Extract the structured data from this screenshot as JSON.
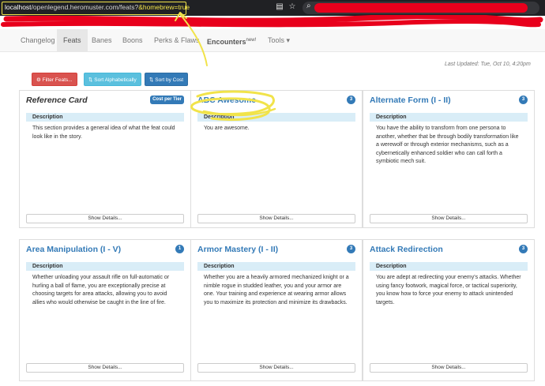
{
  "browser": {
    "url_domain": "localhost",
    "url_path": "/openlegend.heromuster.com/feats?",
    "url_highlight": "&homebrew=true",
    "icons": [
      "reader-mode-icon",
      "bookmark-star-icon",
      "search-icon"
    ]
  },
  "nav": {
    "items": [
      {
        "label": "Changelog"
      },
      {
        "label": "Feats"
      },
      {
        "label": "Banes"
      },
      {
        "label": "Boons"
      },
      {
        "label": "Perks & Flaws"
      },
      {
        "label": "Encounters",
        "sup": "new!"
      },
      {
        "label": "Tools",
        "caret": "▾"
      }
    ]
  },
  "last_updated": "Last Updated: Tue, Oct 10, 4:20pm",
  "toolbar": {
    "filter_label": "Filter Feats...",
    "sort_alpha_label": "Sort Alphabetically",
    "sort_cost_label": "Sort by Cost"
  },
  "cards": [
    {
      "title": "Reference Card",
      "badge": "Cost per Tier",
      "desc_header": "Description",
      "desc": "This section provides a general idea of what the feat could look like in the story.",
      "show": "Show Details..."
    },
    {
      "title": "ABC Awesome",
      "badge": "3",
      "desc_header": "Description",
      "desc": "You are awesome.",
      "show": "Show Details..."
    },
    {
      "title": "Alternate Form (I - II)",
      "badge": "3",
      "desc_header": "Description",
      "desc": "You have the ability to transform from one persona to another, whether that be through bodily transformation like a werewolf or through exterior mechanisms, such as a cybernetically enhanced soldier who can call forth a symbiotic mech suit.",
      "show": "Show Details..."
    },
    {
      "title": "Area Manipulation (I - V)",
      "badge": "1",
      "desc_header": "Description",
      "desc": "Whether unloading your assault rifle on full-automatic or hurling a ball of flame, you are exceptionally precise at choosing targets for area attacks, allowing you to avoid allies who would otherwise be caught in the line of fire.",
      "show": "Show Details..."
    },
    {
      "title": "Armor Mastery (I - II)",
      "badge": "3",
      "desc_header": "Description",
      "desc": "Whether you are a heavily armored mechanized knight or a nimble rogue in studded leather, you and your armor are one. Your training and experience at wearing armor allows you to maximize its protection and minimize its drawbacks.",
      "show": "Show Details..."
    },
    {
      "title": "Attack Redirection",
      "badge": "3",
      "desc_header": "Description",
      "desc": "You are adept at redirecting your enemy's attacks. Whether using fancy footwork, magical force, or tactical superiority, you know how to force your enemy to attack unintended targets.",
      "show": "Show Details..."
    }
  ],
  "colors": {
    "annotation": "#f1e34a",
    "redaction": "#e8001c",
    "link": "#337ab7",
    "desc_header_bg": "#d9edf7"
  }
}
